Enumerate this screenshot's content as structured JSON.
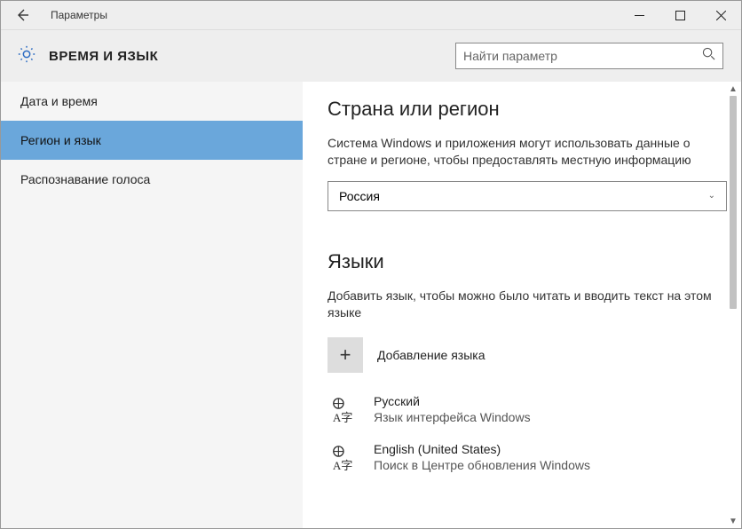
{
  "titlebar": {
    "caption": "Параметры"
  },
  "header": {
    "title": "ВРЕМЯ И ЯЗЫК",
    "search_placeholder": "Найти параметр"
  },
  "sidebar": {
    "items": [
      {
        "label": "Дата и время",
        "selected": false
      },
      {
        "label": "Регион и язык",
        "selected": true
      },
      {
        "label": "Распознавание голоса",
        "selected": false
      }
    ]
  },
  "main": {
    "region": {
      "heading": "Страна или регион",
      "description": "Система Windows и приложения могут использовать данные о стране и регионе, чтобы предоставлять местную информацию",
      "selected": "Россия"
    },
    "languages": {
      "heading": "Языки",
      "description": "Добавить язык, чтобы можно было читать и вводить текст на этом языке",
      "add_label": "Добавление языка",
      "list": [
        {
          "name": "Русский",
          "subtitle": "Язык интерфейса Windows"
        },
        {
          "name": "English (United States)",
          "subtitle": "Поиск в Центре обновления Windows"
        }
      ]
    }
  }
}
